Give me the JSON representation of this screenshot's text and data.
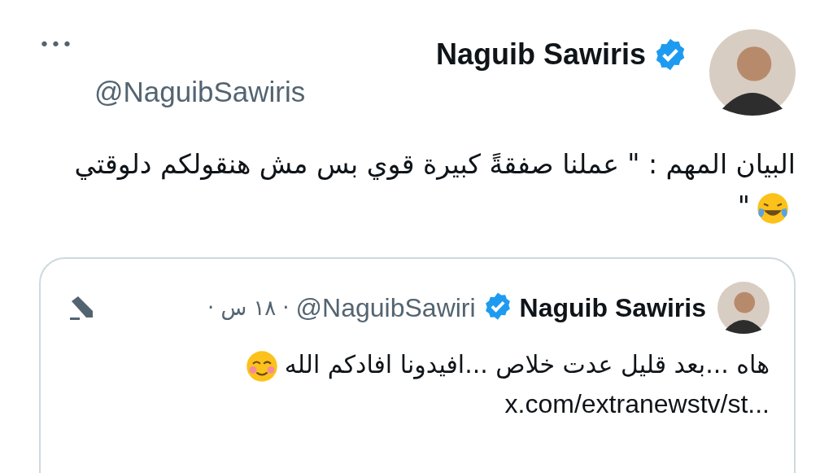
{
  "tweet": {
    "author": {
      "name": "Naguib Sawiris",
      "handle": "@NaguibSawiris",
      "verified": true
    },
    "more": "•••",
    "text": "البيان المهم : \" عملنا صفقةً كبيرة قوي بس مش هنقولكم دلوقتي",
    "text_end": "\"",
    "quoted": {
      "author": {
        "name": "Naguib Sawiris",
        "handle": "@NaguibSawiri",
        "verified": true
      },
      "time": "١٨ س",
      "separator": "·",
      "text": "هاه ...بعد قليل عدت خلاص ...افيدونا افادكم الله",
      "link": "x.com/extranewstv/st..."
    }
  }
}
